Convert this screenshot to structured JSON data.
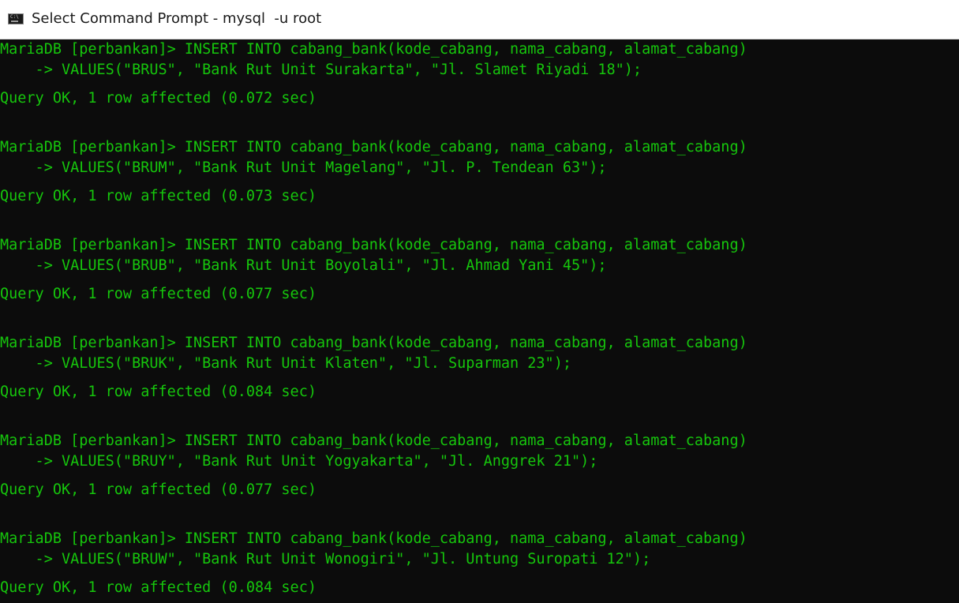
{
  "window": {
    "title": "Select Command Prompt - mysql  -u root",
    "icon": "command-prompt-icon",
    "icon_glyph": "C:\\"
  },
  "colors": {
    "console_background": "#0c0c0c",
    "console_text": "#16c60c",
    "titlebar_background": "#ffffff"
  },
  "console": {
    "lines": [
      "MariaDB [perbankan]> INSERT INTO cabang_bank(kode_cabang, nama_cabang, alamat_cabang)",
      "    -> VALUES(\"BRUS\", \"Bank Rut Unit Surakarta\", \"Jl. Slamet Riyadi 18\");",
      "Query OK, 1 row affected (0.072 sec)",
      "MariaDB [perbankan]> INSERT INTO cabang_bank(kode_cabang, nama_cabang, alamat_cabang)",
      "    -> VALUES(\"BRUM\", \"Bank Rut Unit Magelang\", \"Jl. P. Tendean 63\");",
      "Query OK, 1 row affected (0.073 sec)",
      "MariaDB [perbankan]> INSERT INTO cabang_bank(kode_cabang, nama_cabang, alamat_cabang)",
      "    -> VALUES(\"BRUB\", \"Bank Rut Unit Boyolali\", \"Jl. Ahmad Yani 45\");",
      "Query OK, 1 row affected (0.077 sec)",
      "MariaDB [perbankan]> INSERT INTO cabang_bank(kode_cabang, nama_cabang, alamat_cabang)",
      "    -> VALUES(\"BRUK\", \"Bank Rut Unit Klaten\", \"Jl. Suparman 23\");",
      "Query OK, 1 row affected (0.084 sec)",
      "MariaDB [perbankan]> INSERT INTO cabang_bank(kode_cabang, nama_cabang, alamat_cabang)",
      "    -> VALUES(\"BRUY\", \"Bank Rut Unit Yogyakarta\", \"Jl. Anggrek 21\");",
      "Query OK, 1 row affected (0.077 sec)",
      "MariaDB [perbankan]> INSERT INTO cabang_bank(kode_cabang, nama_cabang, alamat_cabang)",
      "    -> VALUES(\"BRUW\", \"Bank Rut Unit Wonogiri\", \"Jl. Untung Suropati 12\");",
      "Query OK, 1 row affected (0.084 sec)"
    ]
  }
}
